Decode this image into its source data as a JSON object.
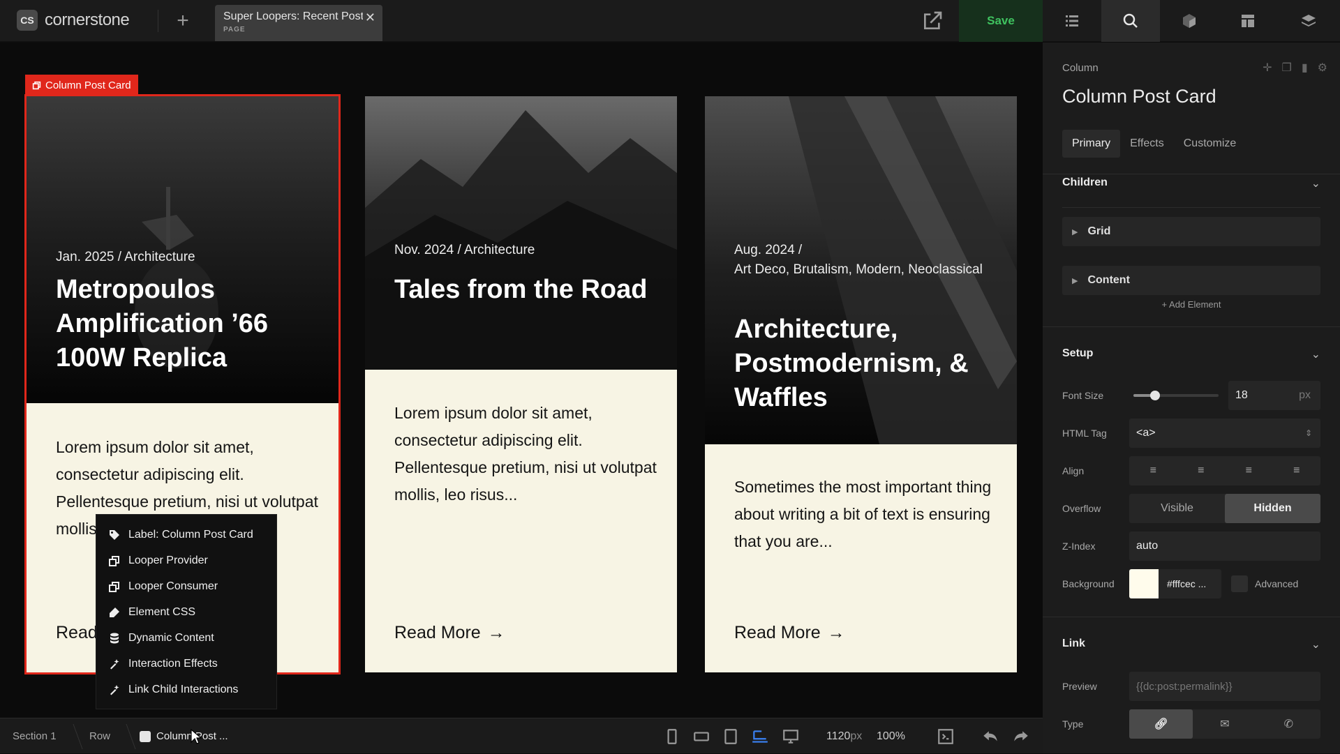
{
  "app": {
    "logo_mark": "CS",
    "logo_text": "cornerstone",
    "doc_tab_title": "Super Loopers: Recent Posts",
    "doc_tab_type": "PAGE",
    "save_label": "Save"
  },
  "canvas": {
    "selected_label": "Column Post Card",
    "cards": [
      {
        "meta": "Jan. 2025 / Architecture",
        "title": "Metropoulos Amplification ’66 100W Replica",
        "body": "Lorem ipsum dolor sit amet, consectetur adipiscing elit. Pellentesque pretium, nisi ut volutpat mollis, leo risus...",
        "read_more": "Read More"
      },
      {
        "meta": "Nov. 2024 / Architecture",
        "title": "Tales from the Road",
        "body": "Lorem ipsum dolor sit amet, consectetur adipiscing elit. Pellentesque pretium, nisi ut volutpat mollis, leo risus...",
        "read_more": "Read More"
      },
      {
        "meta": "Aug. 2024 /\nArt Deco, Brutalism, Modern, Neoclassical",
        "title": "Architecture, Postmodernism, & Waffles",
        "body": "Sometimes the most important thing about writing a bit of text is ensuring that you are...",
        "read_more": "Read More"
      }
    ],
    "context_menu": [
      {
        "label": "Label: Column Post Card",
        "icon": "tag-icon"
      },
      {
        "label": "Looper Provider",
        "icon": "looper-provider-icon"
      },
      {
        "label": "Looper Consumer",
        "icon": "looper-consumer-icon"
      },
      {
        "label": "Element CSS",
        "icon": "css-icon"
      },
      {
        "label": "Dynamic Content",
        "icon": "database-icon"
      },
      {
        "label": "Interaction Effects",
        "icon": "sparkle-icon"
      },
      {
        "label": "Link Child Interactions",
        "icon": "sparkle-icon"
      }
    ]
  },
  "inspector": {
    "element_type": "Column",
    "element_name": "Column Post Card",
    "tabs": [
      "Primary",
      "Effects",
      "Customize"
    ],
    "active_tab": "Primary",
    "children": {
      "heading": "Children",
      "items": [
        "Grid",
        "Content"
      ],
      "add_label": "Add Element"
    },
    "setup": {
      "heading": "Setup",
      "font_size_label": "Font Size",
      "font_size_value": "18",
      "font_size_unit": "px",
      "font_size_slider_fraction": 0.25,
      "html_tag_label": "HTML Tag",
      "html_tag_value": "<a>",
      "align_label": "Align",
      "overflow_label": "Overflow",
      "overflow_options": [
        "Visible",
        "Hidden"
      ],
      "overflow_selected": "Hidden",
      "zindex_label": "Z-Index",
      "zindex_value": "auto",
      "background_label": "Background",
      "background_value": "#fffcec ...",
      "background_color": "#fffcec",
      "advanced_label": "Advanced"
    },
    "link": {
      "heading": "Link",
      "preview_label": "Preview",
      "preview_placeholder": "{{dc:post:permalink}}",
      "type_label": "Type"
    }
  },
  "bottombar": {
    "breadcrumbs": [
      "Section 1",
      "Row",
      "Column Post ..."
    ],
    "width_value": "1120",
    "width_unit": "px",
    "zoom_value": "100%"
  },
  "colors": {
    "accent_red": "#e0271b",
    "save_green": "#3fc25f",
    "card_bg": "#f7f4e4"
  }
}
